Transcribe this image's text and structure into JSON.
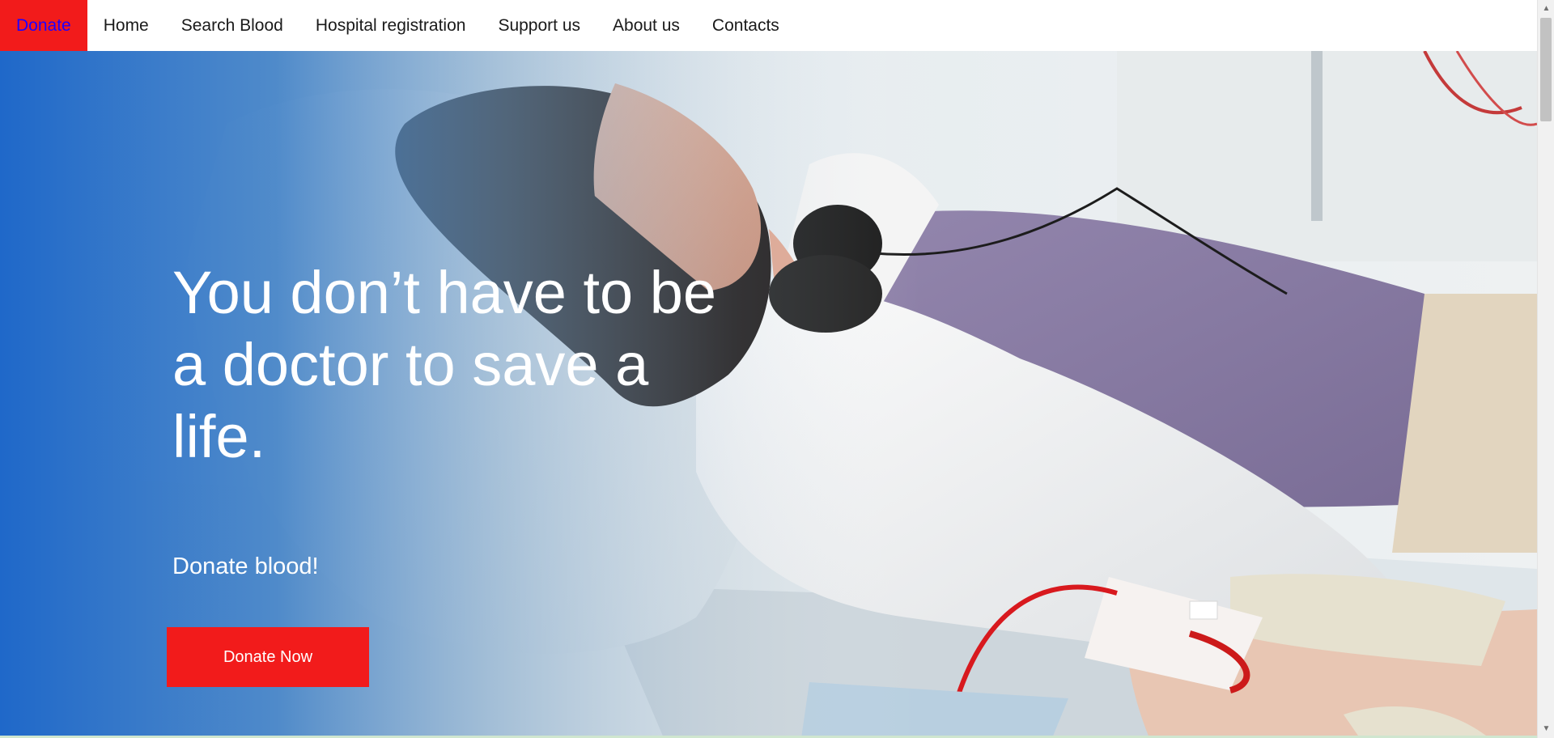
{
  "nav": {
    "items": [
      {
        "label": "Donate",
        "active": true
      },
      {
        "label": "Home"
      },
      {
        "label": "Search Blood"
      },
      {
        "label": "Hospital registration"
      },
      {
        "label": "Support us"
      },
      {
        "label": "About us"
      },
      {
        "label": "Contacts"
      }
    ]
  },
  "hero": {
    "headline": "You don’t have to be a doctor to save a life.",
    "subline": "Donate blood!",
    "cta_label": "Donate Now"
  },
  "colors": {
    "accent_red": "#f21b1b",
    "active_nav_text": "#1f00ff",
    "hero_blue": "#1f68c9"
  },
  "icons": {
    "scroll_up": "scroll-up-arrow-icon",
    "scroll_down": "scroll-down-arrow-icon"
  }
}
